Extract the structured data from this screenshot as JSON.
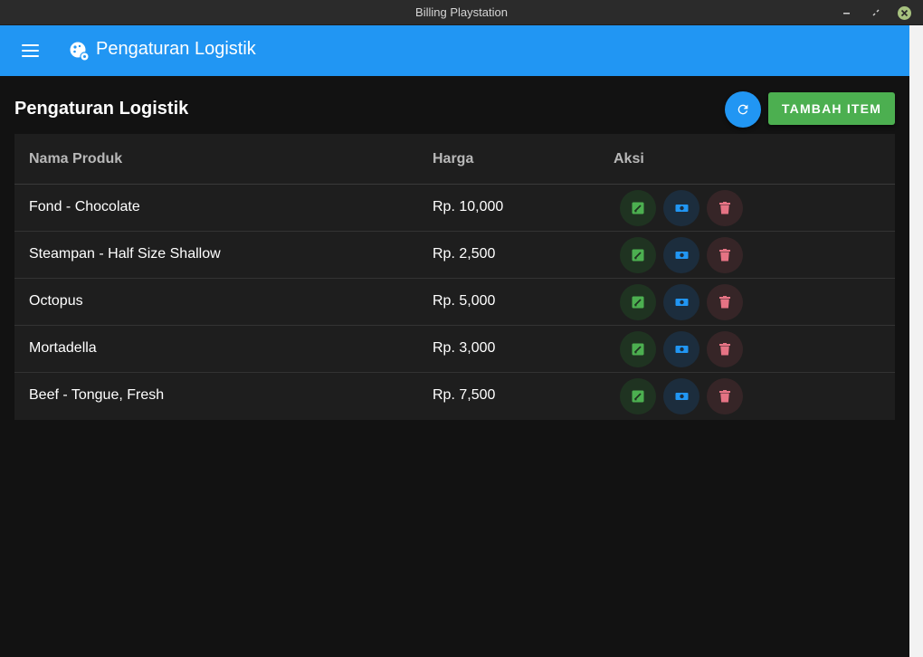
{
  "window": {
    "title": "Billing Playstation"
  },
  "appbar": {
    "title": "Pengaturan Logistik"
  },
  "page": {
    "title": "Pengaturan Logistik",
    "add_button_label": "TAMBAH ITEM"
  },
  "table": {
    "headers": {
      "name": "Nama Produk",
      "price": "Harga",
      "actions": "Aksi"
    },
    "rows": [
      {
        "name": "Fond - Chocolate",
        "price": "Rp. 10,000"
      },
      {
        "name": "Steampan - Half Size Shallow",
        "price": "Rp. 2,500"
      },
      {
        "name": "Octopus",
        "price": "Rp. 5,000"
      },
      {
        "name": "Mortadella",
        "price": "Rp. 3,000"
      },
      {
        "name": "Beef - Tongue, Fresh",
        "price": "Rp. 7,500"
      }
    ]
  },
  "colors": {
    "primary": "#2196f3",
    "success": "#4caf50",
    "edit_icon": "#4caf50",
    "view_icon": "#2196f3",
    "delete_icon": "#e57384",
    "background": "#121212",
    "table_bg": "#1e1e1e"
  },
  "icons": {
    "menu": "menu-icon",
    "app": "cookie-gear-icon",
    "refresh": "refresh-icon",
    "edit": "pencil-box-icon",
    "view": "cash-icon",
    "delete": "trash-icon"
  }
}
